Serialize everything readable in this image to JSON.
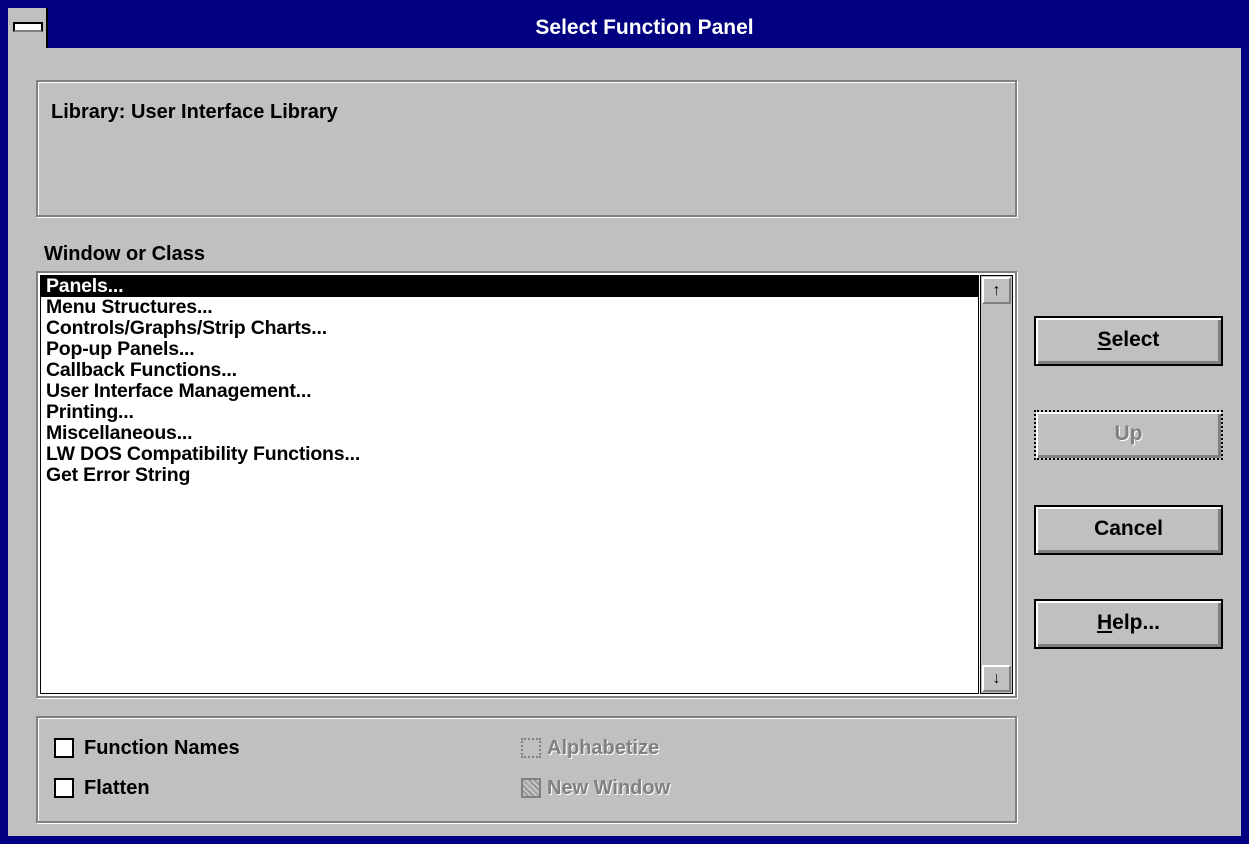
{
  "window": {
    "title": "Select Function Panel"
  },
  "library_text": "Library:  User Interface Library",
  "list": {
    "label": "Window or Class",
    "items": [
      "Panels...",
      "Menu Structures...",
      "Controls/Graphs/Strip Charts...",
      "Pop-up Panels...",
      "Callback Functions...",
      "User Interface Management...",
      "Printing...",
      "Miscellaneous...",
      "LW DOS Compatibility Functions...",
      "Get Error String"
    ],
    "selected_index": 0
  },
  "buttons": {
    "select": {
      "mnemonic": "S",
      "rest": "elect"
    },
    "up": {
      "label": "Up"
    },
    "cancel": {
      "label": "Cancel"
    },
    "help": {
      "mnemonic": "H",
      "rest": "elp..."
    }
  },
  "options": {
    "function_names": {
      "label": "Function Names",
      "checked": false
    },
    "flatten": {
      "label": "Flatten",
      "checked": false
    },
    "alphabetize": {
      "label": "Alphabetize",
      "enabled": false
    },
    "new_window": {
      "label": "New Window",
      "enabled": false
    }
  },
  "icons": {
    "scroll_up": "↑",
    "scroll_down": "↓"
  }
}
